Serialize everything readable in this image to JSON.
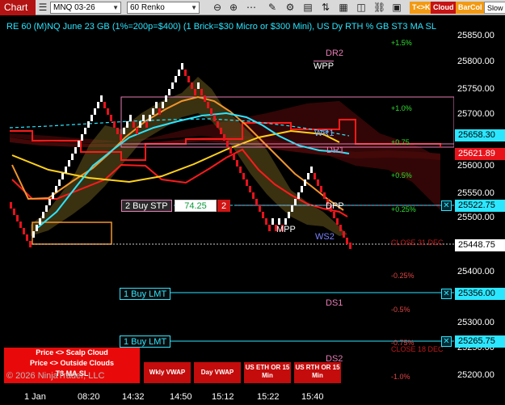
{
  "toolbar": {
    "chart_tab": "Chart",
    "instrument": "MNQ 03-26",
    "bar_type": "60 Renko",
    "btn_tk": "T<>K",
    "btn_cloud": "Cloud",
    "btn_barcol": "BarCol",
    "btn_slow": "Slow"
  },
  "header_text": "RE 60 (M)NQ June 23 GB (1%=200p=$400) (1 Brick=$30 Micro or $300 Mini), US Dy RTH % GB ST3 MA SL",
  "y_axis": {
    "ticks": [
      "25850.00",
      "25800.00",
      "25750.00",
      "25700.00",
      "25650.00",
      "25600.00",
      "25550.00",
      "25500.00",
      "25450.00",
      "25400.00",
      "25350.00",
      "25300.00",
      "25250.00",
      "25200.00"
    ]
  },
  "x_axis": {
    "ticks": [
      "1 Jan",
      "08:20",
      "14:32",
      "14:50",
      "15:12",
      "15:22",
      "15:40"
    ]
  },
  "percent_labels": {
    "p15": "+1.5%",
    "p10": "+1.0%",
    "p075": "+0.75",
    "p05": "+0.5%",
    "p025": "+0.25%",
    "m025": "-0.25%",
    "m05": "-0.5%",
    "m075": "-0.75%",
    "m10": "-1.0%"
  },
  "levels": {
    "dr2": "DR2",
    "wpp": "WPP",
    "wr1": "WR1",
    "dr1": "DR1",
    "dpp": "DPP",
    "mpp": "MPP",
    "ws2": "WS2",
    "ds1": "DS1",
    "ds2": "DS2"
  },
  "close_labels": {
    "close31": "CLOSE 31 DEC",
    "close18": "CLOSE 18 DEC"
  },
  "price_boxes": {
    "p1": "25658.30",
    "p2": "25621.89",
    "p3": "25522.75",
    "p4": "25448.75",
    "p5": "25356.00",
    "p6": "25265.75"
  },
  "orders": {
    "buy_stp_label": "2 Buy STP",
    "buy_stp_price": "74.25",
    "buy_stp_qty": "2",
    "buy_lmt1": "1 Buy LMT",
    "buy_lmt2": "1 Buy LMT",
    "cancel_glyph": "✕"
  },
  "indicators": {
    "scalp_cloud": "Price <> Scalp Cloud",
    "outside_clouds": "Price <> Outside Clouds",
    "t3_ma_sl": "T3 MA SL",
    "wkly_vwap": "Wkly VWAP",
    "day_vwap": "Day VWAP",
    "us_eth_or": "US ETH OR 15 Min",
    "us_rth_or": "US RTH OR 15 Min"
  },
  "copyright": "© 2026 NinjaTrader, LLC",
  "colors": {
    "background": "#000000",
    "bull_brick": "#ffffff",
    "bear_brick": "#e8121b",
    "cyan_accent": "#2be6ff",
    "pivot_magenta": "#e77bb5",
    "pct_green": "#2fe02f",
    "pct_red": "#e04545"
  }
}
